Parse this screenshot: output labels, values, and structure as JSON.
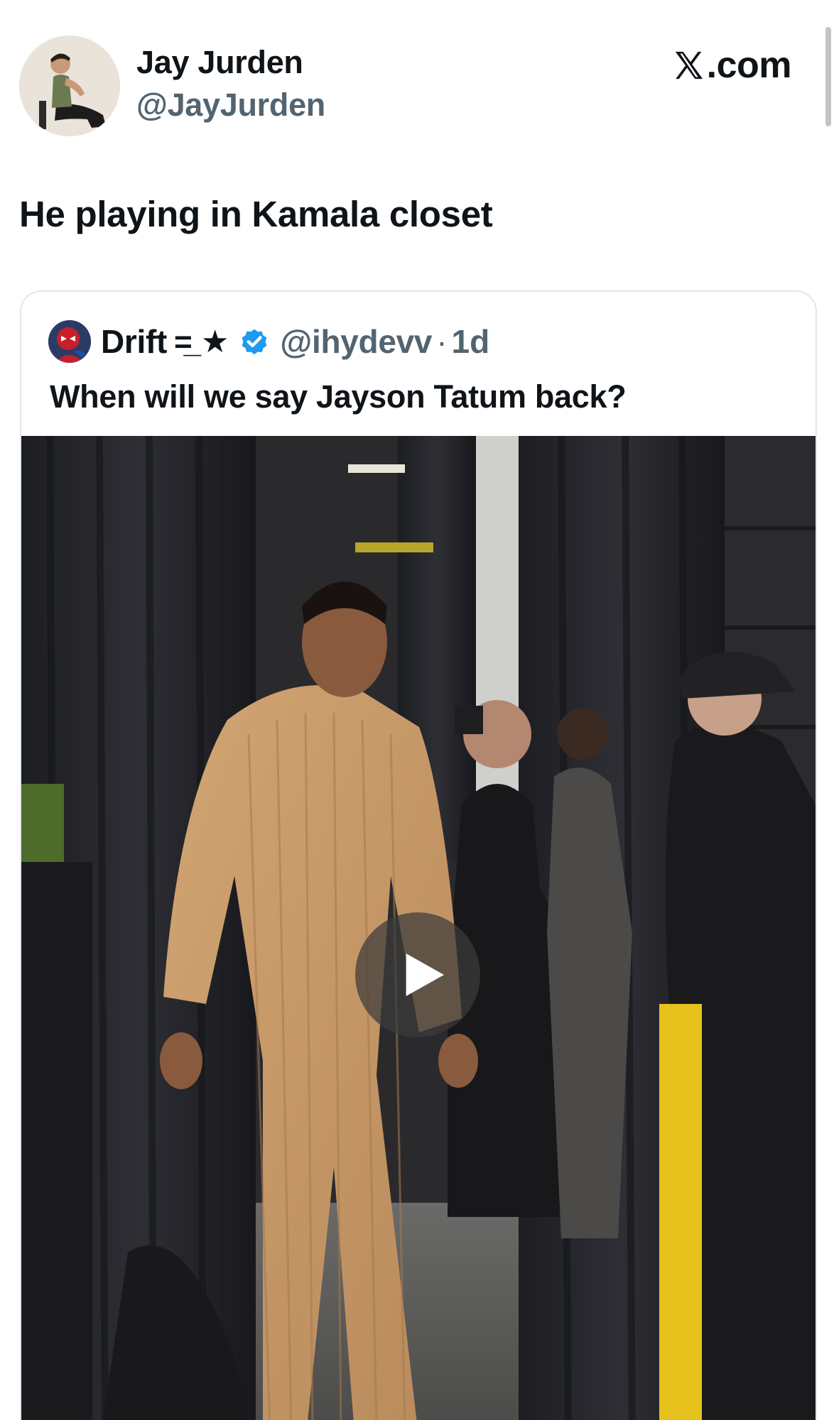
{
  "author": {
    "display_name": "Jay Jurden",
    "handle": "@JayJurden",
    "avatar_icon": "user-avatar-photo"
  },
  "brand": {
    "label": ".com",
    "icon": "x-logo-icon"
  },
  "tweet": {
    "text": "He playing in Kamala closet"
  },
  "quoted_tweet": {
    "display_name": "Drift",
    "name_decoration": "=̲ ★",
    "verified_icon": "verified-badge-icon",
    "handle": "@ihydevv",
    "separator": "·",
    "time": "1d",
    "text": "When will we say Jayson Tatum back?",
    "media": {
      "type": "video",
      "play_icon": "play-icon"
    }
  },
  "colors": {
    "text_primary": "#0f1419",
    "text_secondary": "#536471",
    "border": "#e1e8ed",
    "verified_blue": "#1d9bf0"
  }
}
